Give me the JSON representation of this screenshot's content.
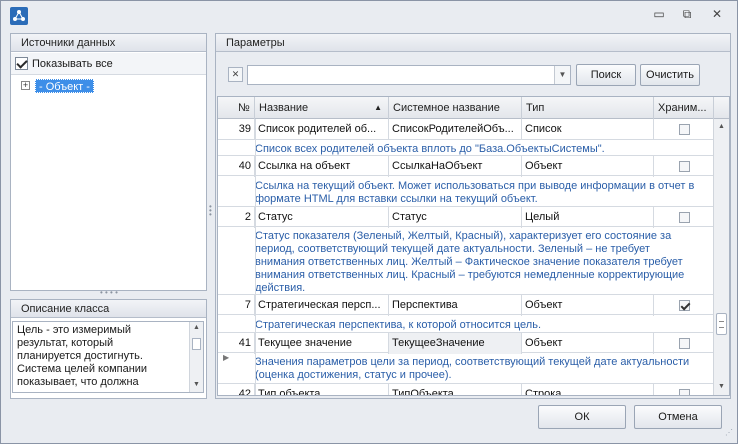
{
  "window": {
    "minimize_glyph": "▭",
    "maximize_glyph": "⧉",
    "close_glyph": "✕"
  },
  "left": {
    "sources_title": "Источники данных",
    "show_all_label": "Показывать все",
    "show_all_checked": true,
    "tree_expander": "+",
    "tree_node": "- Объект -",
    "class_desc_title": "Описание класса",
    "class_desc_lines": [
      "Цель - это измеримый",
      "результат, который",
      "планируется достигнуть.",
      "Система целей компании",
      "показывает, что должна"
    ]
  },
  "right": {
    "params_title": "Параметры",
    "search_value": "",
    "search_button": "Поиск",
    "clear_button": "Очистить",
    "columns": [
      "№",
      "Название",
      "Системное название",
      "Тип",
      "Хранимый"
    ],
    "header_hranim_visible": "Храним...",
    "rows": [
      {
        "num": "39",
        "name": "Список родителей об...",
        "sys": "СписокРодителейОбъ...",
        "type": "Список",
        "stored": false,
        "desc": [
          "Список всех родителей объекта вплоть до \"База.ОбъектыСистемы\"."
        ]
      },
      {
        "num": "40",
        "name": "Ссылка на объект",
        "sys": "СсылкаНаОбъект",
        "type": "Объект",
        "stored": false,
        "desc": [
          "Ссылка на текущий объект. Может использоваться при выводе информации в отчет в",
          "формате HTML для вставки ссылки на текущий объект."
        ]
      },
      {
        "num": "2",
        "name": "Статус",
        "sys": "Статус",
        "type": "Целый",
        "stored": false,
        "desc": [
          "Статус показателя (Зеленый, Желтый, Красный), характеризует его состояние за",
          "период, соответствующий текущей дате актуальности. Зеленый – не требует",
          "внимания ответственных лиц. Желтый – Фактическое значение показателя требует",
          "внимания ответственных лиц. Красный – требуются немедленные корректирующие",
          "действия."
        ]
      },
      {
        "num": "7",
        "name": "Стратегическая персп...",
        "sys": "Перспектива",
        "type": "Объект",
        "stored": true,
        "desc": [
          "Стратегическая перспектива, к которой относится цель."
        ]
      },
      {
        "num": "41",
        "name": "Текущее значение",
        "sys": "ТекущееЗначение",
        "type": "Объект",
        "stored": false,
        "desc": [
          "Значения параметров цели за период, соответствующий текущей дате актуальности",
          "(оценка достижения, статус и прочее)."
        ]
      },
      {
        "num": "42",
        "name": "Тип объекта",
        "sys": "ТипОбъекта",
        "type": "Строка",
        "stored": false,
        "desc": []
      }
    ]
  },
  "footer": {
    "ok": "ОК",
    "cancel": "Отмена"
  }
}
